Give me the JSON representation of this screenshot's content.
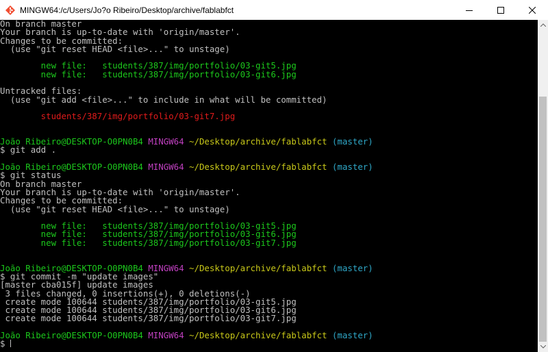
{
  "window": {
    "title": "MINGW64:/c/Users/Jo?o Ribeiro/Desktop/archive/fablabfct",
    "app_icon": "git-bash-icon",
    "controls": [
      "minimize-icon",
      "maximize-icon",
      "close-icon"
    ]
  },
  "colors": {
    "background": "#000000",
    "text": "#c0c0c0",
    "green": "#1cc81c",
    "red": "#e01b1b",
    "magenta": "#c040c0",
    "yellow": "#c8c819",
    "cyan": "#2fa8c8"
  },
  "terminal": {
    "lines": [
      [
        {
          "t": "On branch master"
        }
      ],
      [
        {
          "t": "Your branch is up-to-date with 'origin/master'."
        }
      ],
      [
        {
          "t": "Changes to be committed:"
        }
      ],
      [
        {
          "t": "  (use \"git reset HEAD <file>...\" to unstage)"
        }
      ],
      [
        {
          "t": ""
        }
      ],
      [
        {
          "t": "        new file:   students/387/img/portfolio/03-git5.jpg",
          "c": "green"
        }
      ],
      [
        {
          "t": "        new file:   students/387/img/portfolio/03-git6.jpg",
          "c": "green"
        }
      ],
      [
        {
          "t": ""
        }
      ],
      [
        {
          "t": "Untracked files:"
        }
      ],
      [
        {
          "t": "  (use \"git add <file>...\" to include in what will be committed)"
        }
      ],
      [
        {
          "t": ""
        }
      ],
      [
        {
          "t": "        students/387/img/portfolio/03-git7.jpg",
          "c": "red"
        }
      ],
      [
        {
          "t": ""
        }
      ],
      [
        {
          "t": ""
        }
      ],
      [
        {
          "t": "João Ribeiro@DESKTOP-O0PN0B4 ",
          "c": "green"
        },
        {
          "t": "MINGW64 ",
          "c": "magenta"
        },
        {
          "t": "~/Desktop/archive/fablabfct",
          "c": "yellow"
        },
        {
          "t": " (master)",
          "c": "cyan"
        }
      ],
      [
        {
          "t": "$ git add ."
        }
      ],
      [
        {
          "t": ""
        }
      ],
      [
        {
          "t": "João Ribeiro@DESKTOP-O0PN0B4 ",
          "c": "green"
        },
        {
          "t": "MINGW64 ",
          "c": "magenta"
        },
        {
          "t": "~/Desktop/archive/fablabfct",
          "c": "yellow"
        },
        {
          "t": " (master)",
          "c": "cyan"
        }
      ],
      [
        {
          "t": "$ git status"
        }
      ],
      [
        {
          "t": "On branch master"
        }
      ],
      [
        {
          "t": "Your branch is up-to-date with 'origin/master'."
        }
      ],
      [
        {
          "t": "Changes to be committed:"
        }
      ],
      [
        {
          "t": "  (use \"git reset HEAD <file>...\" to unstage)"
        }
      ],
      [
        {
          "t": ""
        }
      ],
      [
        {
          "t": "        new file:   students/387/img/portfolio/03-git5.jpg",
          "c": "green"
        }
      ],
      [
        {
          "t": "        new file:   students/387/img/portfolio/03-git6.jpg",
          "c": "green"
        }
      ],
      [
        {
          "t": "        new file:   students/387/img/portfolio/03-git7.jpg",
          "c": "green"
        }
      ],
      [
        {
          "t": ""
        }
      ],
      [
        {
          "t": ""
        }
      ],
      [
        {
          "t": "João Ribeiro@DESKTOP-O0PN0B4 ",
          "c": "green"
        },
        {
          "t": "MINGW64 ",
          "c": "magenta"
        },
        {
          "t": "~/Desktop/archive/fablabfct",
          "c": "yellow"
        },
        {
          "t": " (master)",
          "c": "cyan"
        }
      ],
      [
        {
          "t": "$ git commit -m \"update images\""
        }
      ],
      [
        {
          "t": "[master cba015f] update images"
        }
      ],
      [
        {
          "t": " 3 files changed, 0 insertions(+), 0 deletions(-)"
        }
      ],
      [
        {
          "t": " create mode 100644 students/387/img/portfolio/03-git5.jpg"
        }
      ],
      [
        {
          "t": " create mode 100644 students/387/img/portfolio/03-git6.jpg"
        }
      ],
      [
        {
          "t": " create mode 100644 students/387/img/portfolio/03-git7.jpg"
        }
      ],
      [
        {
          "t": ""
        }
      ],
      [
        {
          "t": "João Ribeiro@DESKTOP-O0PN0B4 ",
          "c": "green"
        },
        {
          "t": "MINGW64 ",
          "c": "magenta"
        },
        {
          "t": "~/Desktop/archive/fablabfct",
          "c": "yellow"
        },
        {
          "t": " (master)",
          "c": "cyan"
        }
      ],
      [
        {
          "t": "$ "
        }
      ]
    ]
  },
  "scrollbar": {
    "position_fraction": 0.22
  }
}
